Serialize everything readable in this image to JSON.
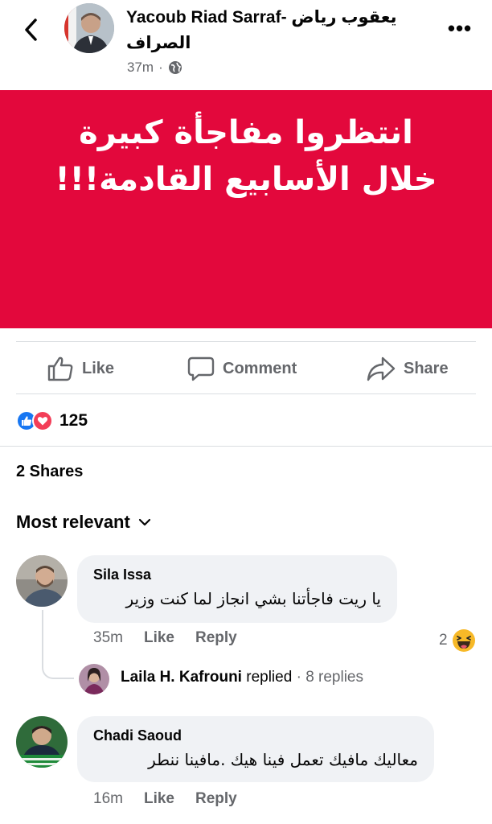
{
  "header": {
    "back_icon": "back-chevron-icon",
    "author_name": "Yacoub Riad Sarraf- يعقوب رياض الصراف",
    "time": "37m",
    "separator": "·",
    "privacy_icon": "globe-icon",
    "more_icon": "more-horizontal-icon",
    "more_label": "•••"
  },
  "post": {
    "background_color": "#e3083c",
    "line1": "انتظروا مفاجأة كبيرة",
    "line2": "خلال الأسابيع القادمة!!!"
  },
  "actions": {
    "like": "Like",
    "comment": "Comment",
    "share": "Share"
  },
  "reactions": {
    "types": [
      "like",
      "love"
    ],
    "count": "125"
  },
  "shares_text": "2 Shares",
  "sort_label": "Most relevant",
  "comments": [
    {
      "author": "Sila Issa",
      "text": "يا ريت فاجأتنا بشي انجاز لما كنت وزير",
      "time": "35m",
      "like": "Like",
      "reply": "Reply",
      "reaction_count": "2",
      "reaction_type": "haha",
      "replies": {
        "author": "Laila H. Kafrouni",
        "action": "replied",
        "separator": "·",
        "count_text": "8 replies"
      }
    },
    {
      "author": "Chadi Saoud",
      "text": "معاليك مافيك تعمل فينا هيك .مافينا ننطر",
      "time": "16m",
      "like": "Like",
      "reply": "Reply"
    }
  ],
  "colors": {
    "accent": "#1877f2",
    "love": "#f33e58",
    "secondary_text": "#65676b",
    "bubble": "#f0f2f5"
  }
}
